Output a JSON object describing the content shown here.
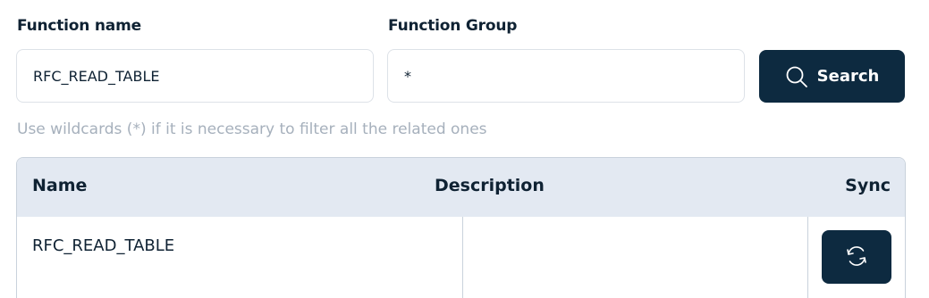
{
  "form": {
    "function_name_label": "Function name",
    "function_name_value": "RFC_READ_TABLE",
    "function_group_label": "Function Group",
    "function_group_value": "*",
    "search_button_label": "Search",
    "hint": "Use wildcards (*) if it is necessary to filter all the related ones"
  },
  "table": {
    "columns": [
      "Name",
      "Description",
      "Sync"
    ],
    "rows": [
      {
        "name": "RFC_READ_TABLE",
        "description": ""
      }
    ]
  },
  "colors": {
    "primary": "#0d2a40",
    "header_bg": "#e3e9f2",
    "hint_text": "#a6b0bc",
    "border": "#c9d2dc"
  },
  "icons": {
    "search": "search-icon",
    "sync": "sync-icon"
  }
}
